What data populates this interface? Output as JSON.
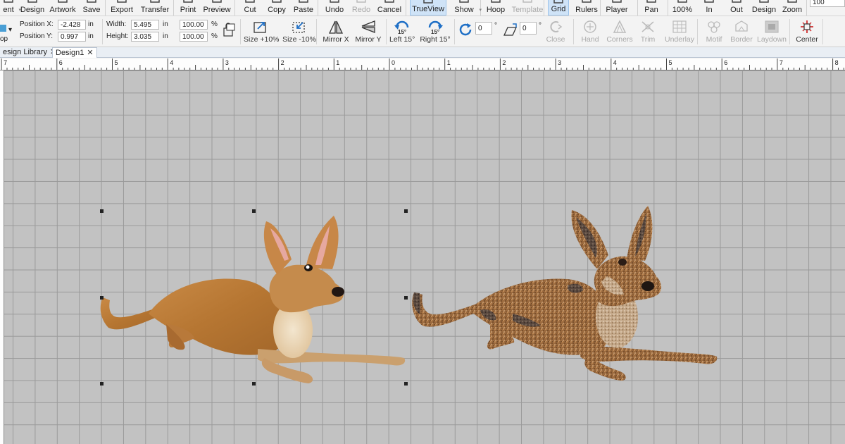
{
  "ribbon": {
    "buttons": [
      {
        "id": "arrange",
        "label": "ent",
        "dropdown": true,
        "disabled": false
      },
      {
        "id": "design",
        "label": "Design",
        "disabled": false
      },
      {
        "id": "artwork",
        "label": "Artwork",
        "disabled": false
      },
      {
        "id": "save",
        "label": "Save",
        "disabled": false
      },
      {
        "id": "export",
        "label": "Export",
        "disabled": false
      },
      {
        "id": "transfer",
        "label": "Transfer",
        "disabled": false
      },
      {
        "id": "print",
        "label": "Print",
        "disabled": false
      },
      {
        "id": "preview",
        "label": "Preview",
        "disabled": false
      },
      {
        "id": "cut",
        "label": "Cut",
        "disabled": false
      },
      {
        "id": "copy",
        "label": "Copy",
        "disabled": false
      },
      {
        "id": "paste",
        "label": "Paste",
        "disabled": false
      },
      {
        "id": "undo",
        "label": "Undo",
        "disabled": false
      },
      {
        "id": "redo",
        "label": "Redo",
        "disabled": true
      },
      {
        "id": "cancel",
        "label": "Cancel",
        "disabled": false
      },
      {
        "id": "trueview",
        "label": "TrueView",
        "disabled": false,
        "active": true
      },
      {
        "id": "show",
        "label": "Show",
        "dropdown": true,
        "disabled": false
      },
      {
        "id": "hoop",
        "label": "Hoop",
        "disabled": false
      },
      {
        "id": "template",
        "label": "Template",
        "disabled": true
      },
      {
        "id": "grid",
        "label": "Grid",
        "disabled": false,
        "active": true
      },
      {
        "id": "rulers",
        "label": "Rulers",
        "disabled": false
      },
      {
        "id": "player",
        "label": "Player",
        "disabled": false
      },
      {
        "id": "pan",
        "label": "Pan",
        "disabled": false
      },
      {
        "id": "zoom100",
        "label": "100%",
        "disabled": false
      },
      {
        "id": "zoomin",
        "label": "In",
        "disabled": false
      },
      {
        "id": "zoomout",
        "label": "Out",
        "disabled": false
      },
      {
        "id": "zoomdesign",
        "label": "Design",
        "disabled": false
      },
      {
        "id": "zoom",
        "label": "Zoom",
        "disabled": false
      }
    ],
    "zoom_value": "100"
  },
  "properties": {
    "mode_label": "op",
    "position_x_label": "Position X:",
    "position_x_value": "-2.428",
    "position_y_label": "Position Y:",
    "position_y_value": "0.997",
    "unit": "in",
    "width_label": "Width:",
    "width_value": "5.495",
    "height_label": "Height:",
    "height_value": "3.035",
    "width_percent": "100.00",
    "height_percent": "100.00",
    "percent_sign": "%",
    "rotate_value": "0",
    "slant_value": "0",
    "degree_sign": "°"
  },
  "tools": [
    {
      "id": "size_up",
      "label": "Size +10%",
      "disabled": false
    },
    {
      "id": "size_down",
      "label": "Size -10%",
      "disabled": false
    },
    {
      "id": "mirror_x",
      "label": "Mirror X",
      "disabled": false
    },
    {
      "id": "mirror_y",
      "label": "Mirror Y",
      "disabled": false
    },
    {
      "id": "left15",
      "label": "Left 15°",
      "disabled": false
    },
    {
      "id": "right15",
      "label": "Right 15°",
      "disabled": false
    },
    {
      "id": "close",
      "label": "Close",
      "disabled": true
    },
    {
      "id": "hand",
      "label": "Hand",
      "disabled": true
    },
    {
      "id": "corners",
      "label": "Corners",
      "disabled": true
    },
    {
      "id": "trim",
      "label": "Trim",
      "disabled": true
    },
    {
      "id": "underlay",
      "label": "Underlay",
      "disabled": true
    },
    {
      "id": "motif",
      "label": "Motif",
      "disabled": true
    },
    {
      "id": "border",
      "label": "Border",
      "disabled": true
    },
    {
      "id": "laydown",
      "label": "Laydown",
      "disabled": true
    },
    {
      "id": "center",
      "label": "Center",
      "disabled": false
    }
  ],
  "rotate_badge": "15°",
  "tabs": [
    {
      "label": "esign Library",
      "close": "✕",
      "active": false
    },
    {
      "label": "Design1",
      "close": "✕",
      "active": true
    }
  ],
  "ruler": {
    "labels": [
      "7",
      "6",
      "5",
      "4",
      "3",
      "2",
      "1",
      "0",
      "1",
      "2",
      "3",
      "4",
      "5",
      "6",
      "7",
      "8"
    ]
  },
  "colors": {
    "canvas_bg": "#c2c2c2",
    "grid_line": "#9a9a9a",
    "accent_blue": "#1e6fc6",
    "center_red": "#d32f2f"
  }
}
